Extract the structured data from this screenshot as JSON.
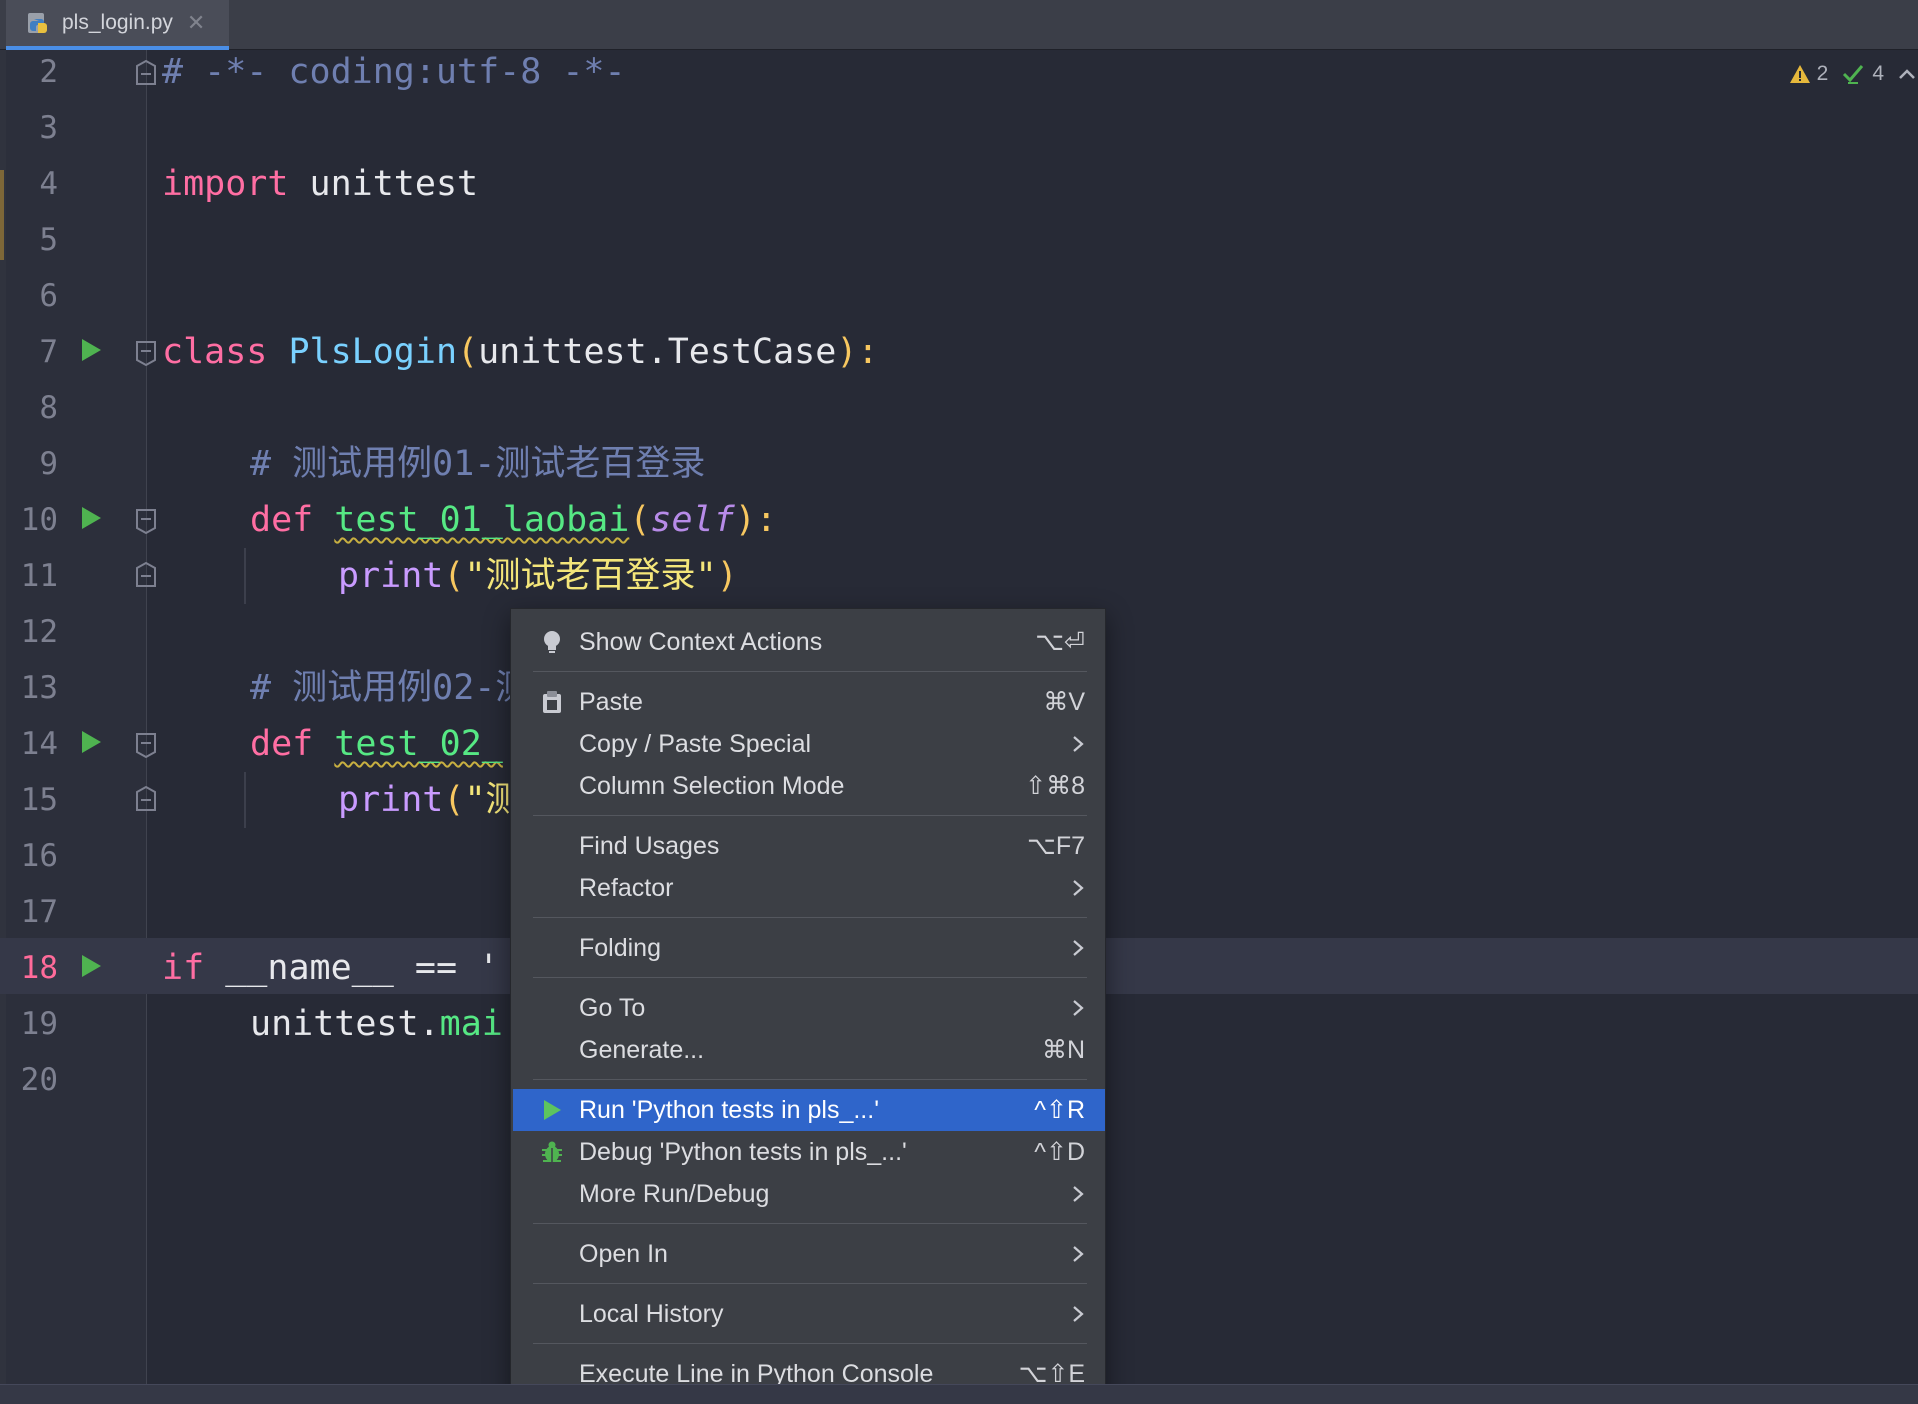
{
  "tab": {
    "filename": "pls_login.py"
  },
  "inspections": {
    "warnings": "2",
    "checks": "4"
  },
  "editor": {
    "line_numbers": [
      "2",
      "3",
      "4",
      "5",
      "6",
      "7",
      "8",
      "9",
      "10",
      "11",
      "12",
      "13",
      "14",
      "15",
      "16",
      "17",
      "18",
      "19",
      "20"
    ],
    "active_line": "18",
    "lines": {
      "l2": "# -*- coding:utf-8 -*-",
      "l4_kw": "import",
      "l4_rest": " unittest",
      "l7_kw": "class",
      "l7_cls": "PlsLogin",
      "l7_p1": "(",
      "l7_base": "unittest.TestCase",
      "l7_p2": "):",
      "l9": "# 测试用例01-测试老百登录",
      "l10_kw": "def",
      "l10_fn": "test_01_laobai",
      "l10_p1": "(",
      "l10_self": "self",
      "l10_p2": "):",
      "l11_builtin": "print",
      "l11_p1": "(",
      "l11_str": "\"测试老百登录\"",
      "l11_p2": ")",
      "l13": "# 测试用例02-测",
      "l14_kw": "def",
      "l14_fn": "test_02_",
      "l15_builtin": "print",
      "l15_p1": "(",
      "l15_str": "\"测",
      "l18_kw": "if",
      "l18_rest": " __name__ == '",
      "l19_a": "unittest.",
      "l19_b": "mai"
    }
  },
  "context_menu": {
    "show_context_actions": {
      "label": "Show Context Actions",
      "shortcut": "⌥⏎"
    },
    "paste": {
      "label": "Paste",
      "shortcut": "⌘V"
    },
    "copy_paste_special": {
      "label": "Copy / Paste Special"
    },
    "column_selection_mode": {
      "label": "Column Selection Mode",
      "shortcut": "⇧⌘8"
    },
    "find_usages": {
      "label": "Find Usages",
      "shortcut": "⌥F7"
    },
    "refactor": {
      "label": "Refactor"
    },
    "folding": {
      "label": "Folding"
    },
    "go_to": {
      "label": "Go To"
    },
    "generate": {
      "label": "Generate...",
      "shortcut": "⌘N"
    },
    "run": {
      "label": "Run 'Python tests in pls_...'",
      "shortcut": "^⇧R"
    },
    "debug": {
      "label": "Debug 'Python tests in pls_...'",
      "shortcut": "^⇧D"
    },
    "more_run_debug": {
      "label": "More Run/Debug"
    },
    "open_in": {
      "label": "Open In"
    },
    "local_history": {
      "label": "Local History"
    },
    "execute_line": {
      "label": "Execute Line in Python Console",
      "shortcut": "⌥⇧E"
    }
  },
  "colors": {
    "background": "#272a36",
    "selection": "#2f65ca",
    "run_icon": "#4fb350",
    "keyword": "#ff6ea3"
  }
}
